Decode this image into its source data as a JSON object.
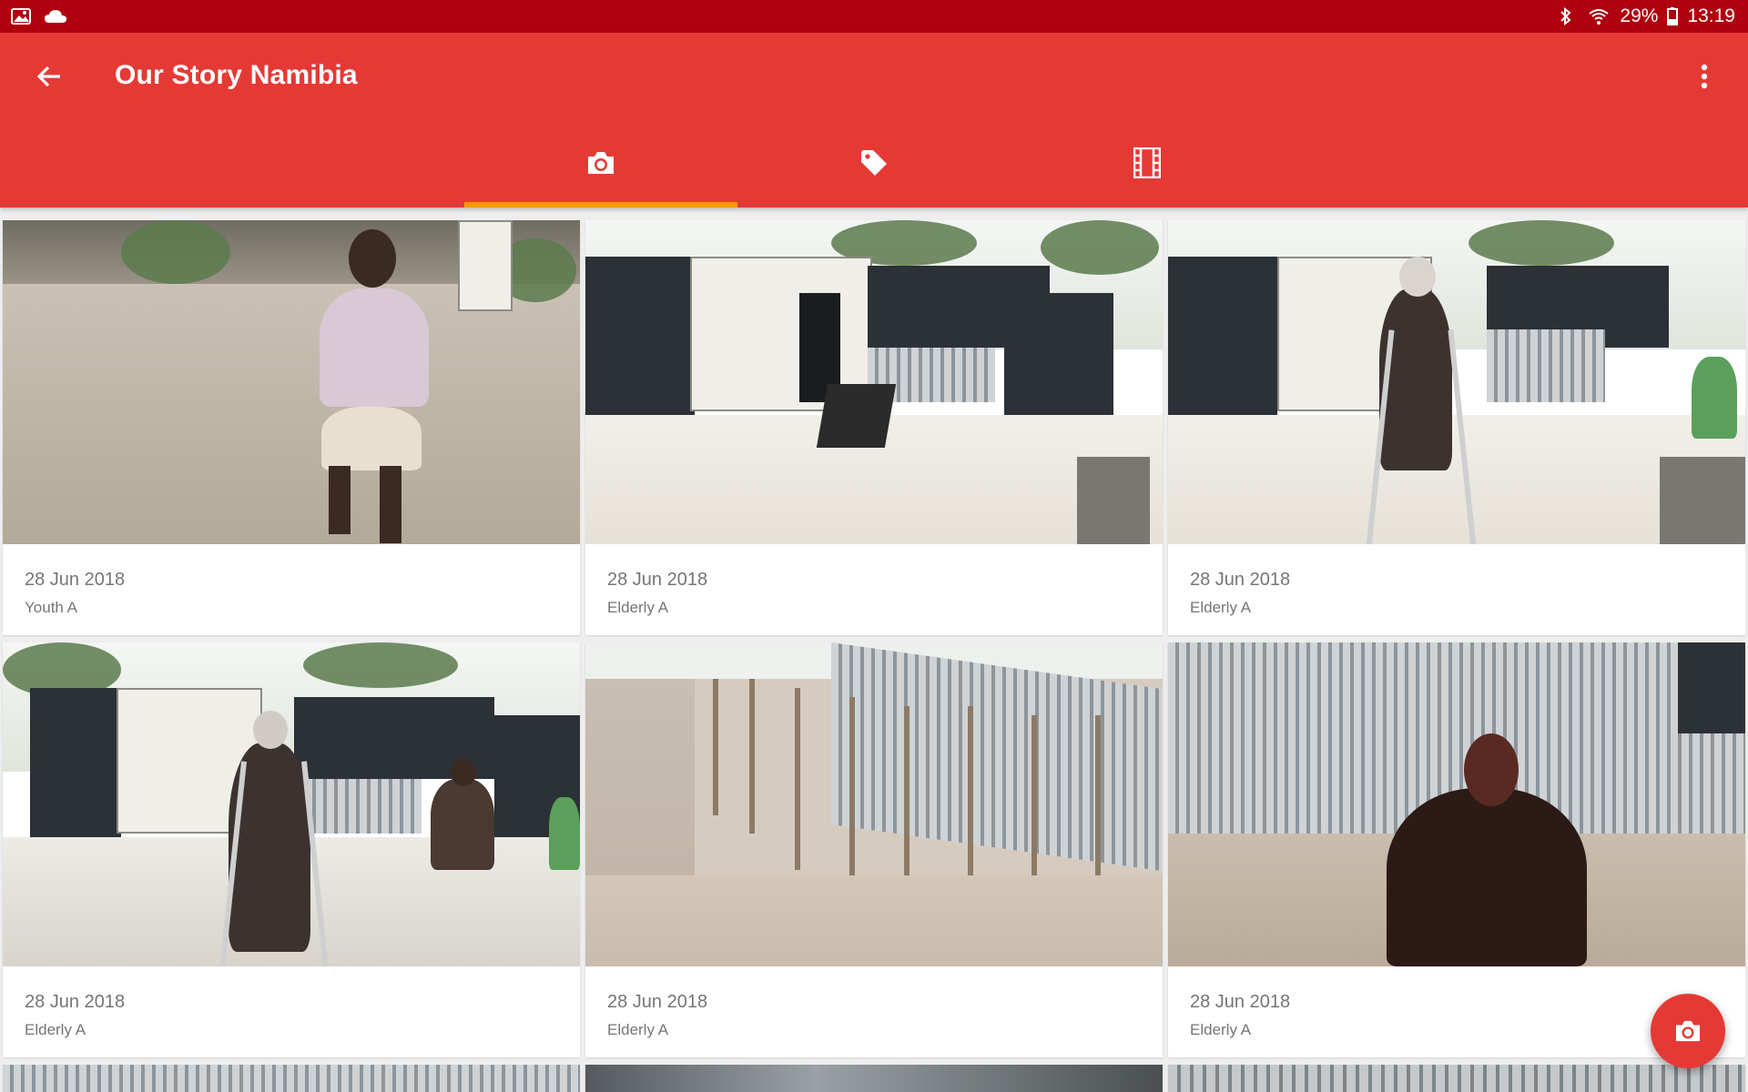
{
  "status_bar": {
    "left_icons": [
      "image-icon",
      "cloud-icon"
    ],
    "right_icons": [
      "bluetooth-icon",
      "wifi-icon",
      "battery-icon"
    ],
    "battery": "29%",
    "time": "13:19"
  },
  "app_bar": {
    "title": "Our Story Namibia",
    "back_icon": "arrow-back-icon",
    "menu_icon": "more-vert-icon",
    "color": "#e53935",
    "status_color": "#b0000e"
  },
  "tabs": [
    {
      "icon": "camera-icon",
      "active": true
    },
    {
      "icon": "tag-icon",
      "active": false
    },
    {
      "icon": "film-icon",
      "active": false
    }
  ],
  "tab_indicator_color": "#ff9800",
  "photos": [
    {
      "date": "28 Jun 2018",
      "label": "Youth A"
    },
    {
      "date": "28 Jun 2018",
      "label": "Elderly A"
    },
    {
      "date": "28 Jun 2018",
      "label": "Elderly A"
    },
    {
      "date": "28 Jun 2018",
      "label": "Elderly A"
    },
    {
      "date": "28 Jun 2018",
      "label": "Elderly A"
    },
    {
      "date": "28 Jun 2018",
      "label": "Elderly A"
    }
  ],
  "fab": {
    "icon": "camera-icon"
  }
}
